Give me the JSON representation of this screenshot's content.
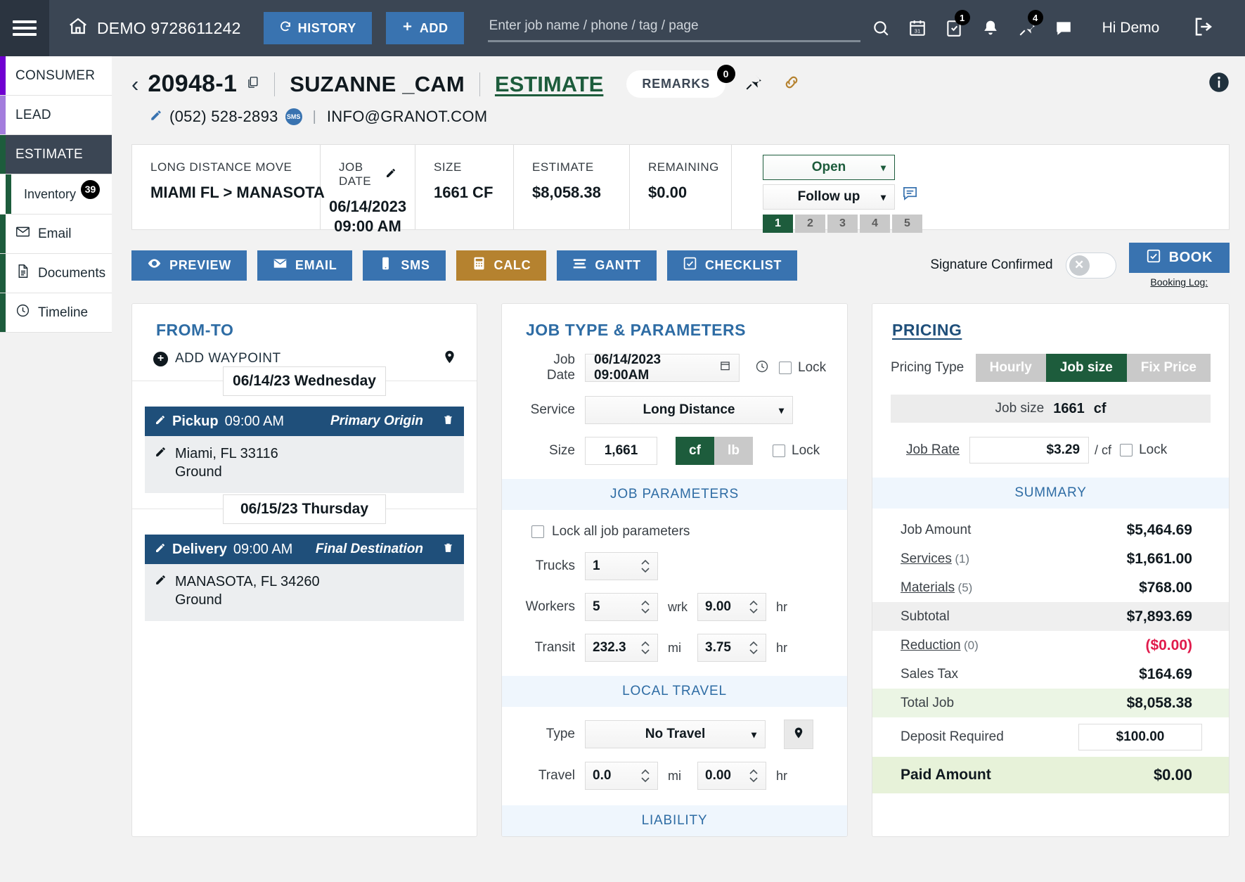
{
  "header": {
    "brand": "DEMO 9728611242",
    "history_label": "HISTORY",
    "add_label": "ADD",
    "search_placeholder": "Enter job name / phone / tag / page",
    "tasks_badge": "1",
    "pin_badge": "4",
    "greeting": "Hi Demo"
  },
  "sidebar": {
    "consumer": "CONSUMER",
    "lead": "LEAD",
    "estimate": "ESTIMATE",
    "inventory": "Inventory",
    "inventory_count": "39",
    "email": "Email",
    "documents": "Documents",
    "timeline": "Timeline"
  },
  "job": {
    "id": "20948-1",
    "customer": "SUZANNE _CAM",
    "stage": "ESTIMATE",
    "remarks_label": "REMARKS",
    "remarks_count": "0",
    "phone": "(052) 528-2893",
    "sms_chip": "SMS",
    "email": "INFO@GRANOT.COM"
  },
  "info_strip": {
    "move_type_label": "LONG DISTANCE MOVE",
    "move_type_value": "MIAMI FL > MANASOTA",
    "job_date_label": "JOB DATE",
    "job_date_value": "06/14/2023",
    "job_time_value": "09:00 AM",
    "size_label": "SIZE",
    "size_value": "1661 CF",
    "estimate_label": "ESTIMATE",
    "estimate_value": "$8,058.38",
    "remaining_label": "REMAINING",
    "remaining_value": "$0.00",
    "status_select": "Open",
    "followup_select": "Follow up",
    "steps": [
      "1",
      "2",
      "3",
      "4",
      "5"
    ],
    "active_step": "1"
  },
  "actions": {
    "preview": "PREVIEW",
    "email": "EMAIL",
    "sms": "SMS",
    "calc": "CALC",
    "gantt": "GANTT",
    "checklist": "CHECKLIST",
    "signature_label": "Signature Confirmed",
    "book": "BOOK",
    "booking_log": "Booking Log:"
  },
  "fromto": {
    "title": "FROM-TO",
    "add_waypoint": "ADD WAYPOINT",
    "days": [
      {
        "date_chip": "06/14/23 Wednesday",
        "type": "Pickup",
        "time": "09:00 AM",
        "role": "Primary Origin",
        "address": "Miami, FL 33116",
        "level": "Ground"
      },
      {
        "date_chip": "06/15/23 Thursday",
        "type": "Delivery",
        "time": "09:00 AM",
        "role": "Final Destination",
        "address": "MANASOTA, FL 34260",
        "level": "Ground"
      }
    ]
  },
  "jobtype": {
    "title": "JOB TYPE & PARAMETERS",
    "job_date_label": "Job Date",
    "job_date_value": "06/14/2023 09:00AM",
    "lock_label": "Lock",
    "service_label": "Service",
    "service_value": "Long Distance",
    "size_label": "Size",
    "size_value": "1,661",
    "unit_cf": "cf",
    "unit_lb": "lb",
    "params_band": "JOB PARAMETERS",
    "lock_all": "Lock all job parameters",
    "trucks_label": "Trucks",
    "trucks_value": "1",
    "workers_label": "Workers",
    "workers_value": "5",
    "workers_unit": "wrk",
    "workers_hours": "9.00",
    "hr_unit": "hr",
    "transit_label": "Transit",
    "transit_value": "232.3",
    "transit_unit": "mi",
    "transit_hours": "3.75",
    "local_travel_band": "LOCAL TRAVEL",
    "type_label": "Type",
    "type_value": "No Travel",
    "travel_label": "Travel",
    "travel_mi": "0.0",
    "travel_mi_unit": "mi",
    "travel_hr": "0.00",
    "liability_band": "LIABILITY"
  },
  "pricing": {
    "title": "PRICING",
    "pricing_type_label": "Pricing Type",
    "type_hourly": "Hourly",
    "type_jobsize": "Job size",
    "type_fixprice": "Fix Price",
    "job_size_label": "Job size",
    "job_size_value": "1661",
    "job_size_unit": "cf",
    "job_rate_label": "Job Rate",
    "job_rate_value": "$3.29",
    "job_rate_unit": "/ cf",
    "lock_label": "Lock",
    "summary_band": "SUMMARY",
    "rows": [
      {
        "label": "Job Amount",
        "count": "",
        "value": "$5,464.69"
      },
      {
        "label": "Services",
        "count": "(1)",
        "value": "$1,661.00"
      },
      {
        "label": "Materials",
        "count": "(5)",
        "value": "$768.00"
      },
      {
        "label": "Subtotal",
        "count": "",
        "value": "$7,893.69"
      },
      {
        "label": "Reduction",
        "count": "(0)",
        "value": "($0.00)"
      },
      {
        "label": "Sales Tax",
        "count": "",
        "value": "$164.69"
      },
      {
        "label": "Total Job",
        "count": "",
        "value": "$8,058.38"
      }
    ],
    "deposit_label": "Deposit Required",
    "deposit_value": "$100.00",
    "paid_label": "Paid Amount",
    "paid_value": "$0.00"
  }
}
